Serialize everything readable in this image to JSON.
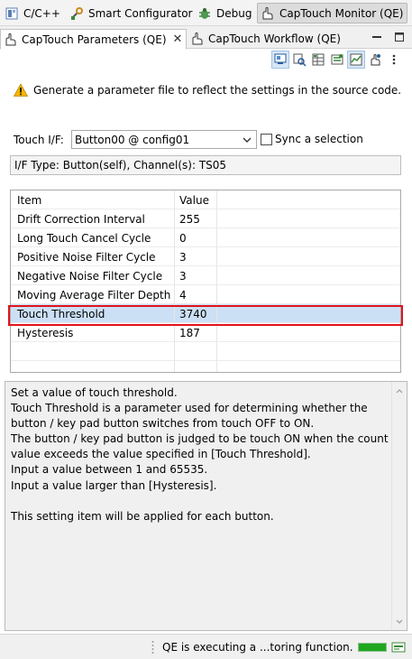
{
  "perspectives": [
    {
      "label": "C/C++",
      "icon": "cpp-perspective-icon"
    },
    {
      "label": "Smart Configurator",
      "icon": "smart-configurator-icon"
    },
    {
      "label": "Debug",
      "icon": "debug-icon"
    },
    {
      "label": "CapTouch Monitor (QE)",
      "icon": "captouch-icon"
    }
  ],
  "tabs": [
    {
      "label": "CapTouch Parameters (QE)"
    },
    {
      "label": "CapTouch Workflow (QE)"
    }
  ],
  "warning": "Generate a parameter file to reflect the settings in the source code.",
  "touch_if": {
    "label": "Touch I/F:",
    "value": "Button00 @ config01",
    "sync_label": "Sync a selection",
    "sync_checked": false
  },
  "if_type": "I/F Type: Button(self), Channel(s): TS05",
  "table": {
    "headers": [
      "Item",
      "Value"
    ],
    "rows": [
      {
        "item": "Drift Correction Interval",
        "value": "255"
      },
      {
        "item": "Long Touch Cancel Cycle",
        "value": "0"
      },
      {
        "item": "Positive Noise Filter Cycle",
        "value": "3"
      },
      {
        "item": "Negative Noise Filter Cycle",
        "value": "3"
      },
      {
        "item": "Moving Average Filter Depth",
        "value": "4"
      },
      {
        "item": "Touch Threshold",
        "value": "3740"
      },
      {
        "item": "Hysteresis",
        "value": "187"
      }
    ],
    "selected_index": 5
  },
  "description": "Set a value of touch threshold.\nTouch Threshold is a parameter used for determining whether the button / key pad button switches from touch OFF to ON.\nThe button / key pad button is judged to be touch ON when the count value exceeds the value specified in [Touch Threshold].\nInput a value between 1 and 65535.\nInput a value larger than [Hysteresis].\n\nThis setting item will be applied for each button.",
  "status": {
    "text": "QE is executing a ...toring function.",
    "progress": 1.0
  },
  "colors": {
    "highlight_border": "#e0141c",
    "selection": "#cce0f5",
    "progress": "#1fa61f",
    "warning": "#f5b400"
  }
}
